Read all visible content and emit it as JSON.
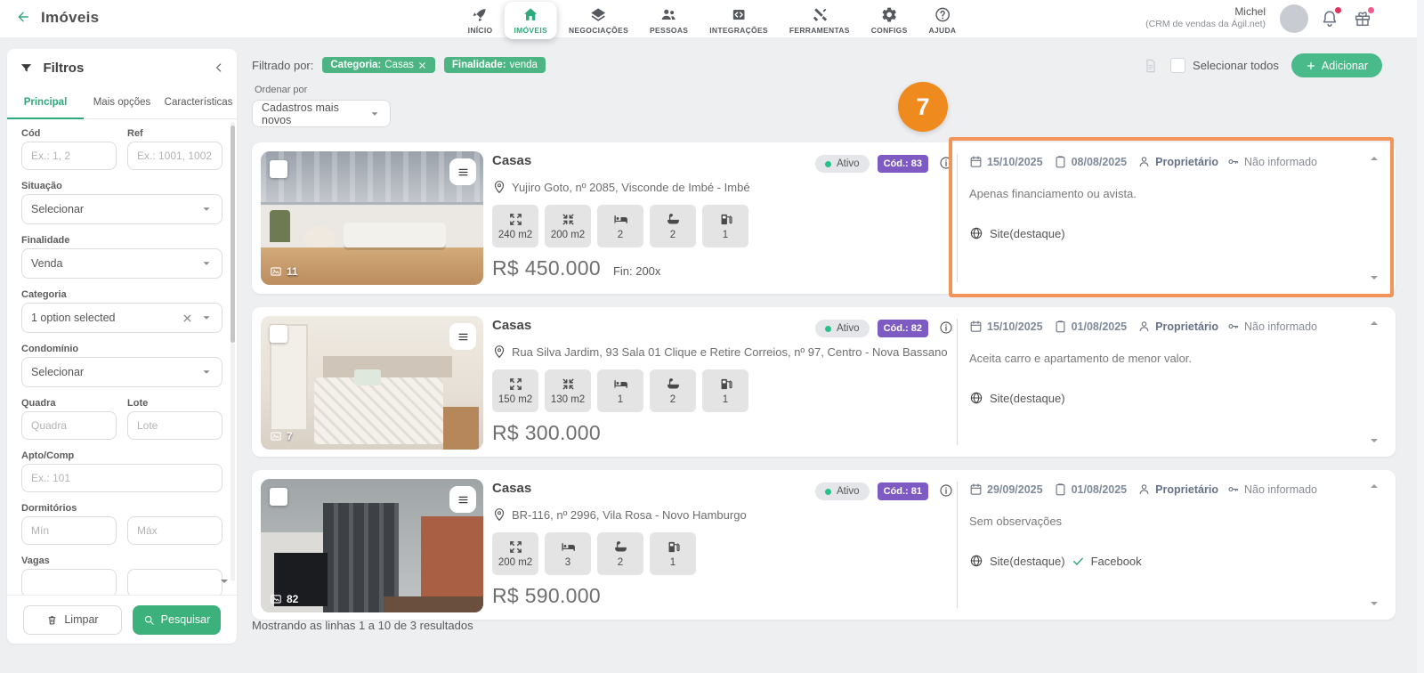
{
  "app": {
    "title": "Imóveis"
  },
  "header": {
    "nav": [
      {
        "label": "INÍCIO"
      },
      {
        "label": "IMÓVEIS"
      },
      {
        "label": "NEGOCIAÇÕES"
      },
      {
        "label": "PESSOAS"
      },
      {
        "label": "INTEGRAÇÕES"
      },
      {
        "label": "FERRAMENTAS"
      },
      {
        "label": "CONFIGS"
      },
      {
        "label": "AJUDA"
      }
    ],
    "user": {
      "name": "Michel",
      "org": "(CRM de vendas da Ágil.net)"
    }
  },
  "sidebar": {
    "title": "Filtros",
    "tabs": [
      {
        "label": "Principal"
      },
      {
        "label": "Mais opções"
      },
      {
        "label": "Características"
      }
    ],
    "fields": {
      "cod": {
        "label": "Cód",
        "placeholder": "Ex.: 1, 2"
      },
      "ref": {
        "label": "Ref",
        "placeholder": "Ex.: 1001, 1002"
      },
      "situacao": {
        "label": "Situação",
        "value": "Selecionar"
      },
      "finalidade": {
        "label": "Finalidade",
        "value": "Venda"
      },
      "categoria": {
        "label": "Categoria",
        "value": "1 option selected"
      },
      "condominio": {
        "label": "Condomínio",
        "value": "Selecionar"
      },
      "quadra": {
        "label": "Quadra",
        "placeholder": "Quadra"
      },
      "lote": {
        "label": "Lote",
        "placeholder": "Lote"
      },
      "apto": {
        "label": "Apto/Comp",
        "placeholder": "Ex.: 101"
      },
      "dormitorios": {
        "label": "Dormitórios",
        "min": "Mín",
        "max": "Máx"
      },
      "vagas": {
        "label": "Vagas"
      }
    },
    "clear_label": "Limpar",
    "search_label": "Pesquisar"
  },
  "toolbar": {
    "filtered_by": "Filtrado por:",
    "chips": [
      {
        "label": "Categoria:",
        "value": "Casas"
      },
      {
        "label": "Finalidade:",
        "value": "venda"
      }
    ],
    "order_label": "Ordenar por",
    "order_value": "Cadastros mais novos",
    "select_all": "Selecionar todos",
    "add_label": "Adicionar"
  },
  "cards": [
    {
      "title": "Casas",
      "status": "Ativo",
      "code": "Cód.: 83",
      "photos": "11",
      "address": "Yujiro Goto, nº 2085, Visconde de Imbé - Imbé",
      "stats": [
        {
          "icon": "total-area",
          "value": "240 m2"
        },
        {
          "icon": "built-area",
          "value": "200 m2"
        },
        {
          "icon": "bedrooms",
          "value": "2"
        },
        {
          "icon": "bathrooms",
          "value": "2"
        },
        {
          "icon": "garage",
          "value": "1"
        }
      ],
      "price": "R$ 450.000",
      "price_extra": "Fin: 200x",
      "updated": "15/10/2025",
      "created": "08/08/2025",
      "owner_label": "Proprietário",
      "keys": "Não informado",
      "note": "Apenas financiamento ou avista.",
      "portals": [
        {
          "label": "Site(destaque)"
        }
      ]
    },
    {
      "title": "Casas",
      "status": "Ativo",
      "code": "Cód.: 82",
      "photos": "7",
      "address": "Rua Silva Jardim, 93 Sala 01 Clique e Retire Correios, nº 97, Centro - Nova Bassano",
      "stats": [
        {
          "icon": "total-area",
          "value": "150 m2"
        },
        {
          "icon": "built-area",
          "value": "130 m2"
        },
        {
          "icon": "bedrooms",
          "value": "1"
        },
        {
          "icon": "bathrooms",
          "value": "2"
        },
        {
          "icon": "garage",
          "value": "1"
        }
      ],
      "price": "R$ 300.000",
      "price_extra": "",
      "updated": "15/10/2025",
      "created": "01/08/2025",
      "owner_label": "Proprietário",
      "keys": "Não informado",
      "note": "Aceita carro e apartamento de menor valor.",
      "portals": [
        {
          "label": "Site(destaque)"
        }
      ]
    },
    {
      "title": "Casas",
      "status": "Ativo",
      "code": "Cód.: 81",
      "photos": "82",
      "address": "BR-116, nº 2996, Vila Rosa - Novo Hamburgo",
      "stats": [
        {
          "icon": "total-area",
          "value": "200 m2"
        },
        {
          "icon": "bedrooms",
          "value": "3"
        },
        {
          "icon": "bathrooms",
          "value": "2"
        },
        {
          "icon": "garage",
          "value": "1"
        }
      ],
      "price": "R$ 590.000",
      "price_extra": "",
      "updated": "29/09/2025",
      "created": "01/08/2025",
      "owner_label": "Proprietário",
      "keys": "Não informado",
      "note": "Sem observações",
      "portals": [
        {
          "label": "Site(destaque)"
        },
        {
          "label": "Facebook",
          "checked": true
        }
      ]
    }
  ],
  "footer": {
    "results": "Mostrando as linhas 1 a 10 de 3 resultados"
  },
  "annotation": {
    "number": "7"
  },
  "colors": {
    "accent_green": "#2fa87a",
    "chip_green": "#4db584",
    "badge_purple": "#7e5bc2",
    "status_dot_green": "#27c285",
    "annotation_orange": "#ef8a1f",
    "highlight_orange": "#f2935a"
  }
}
